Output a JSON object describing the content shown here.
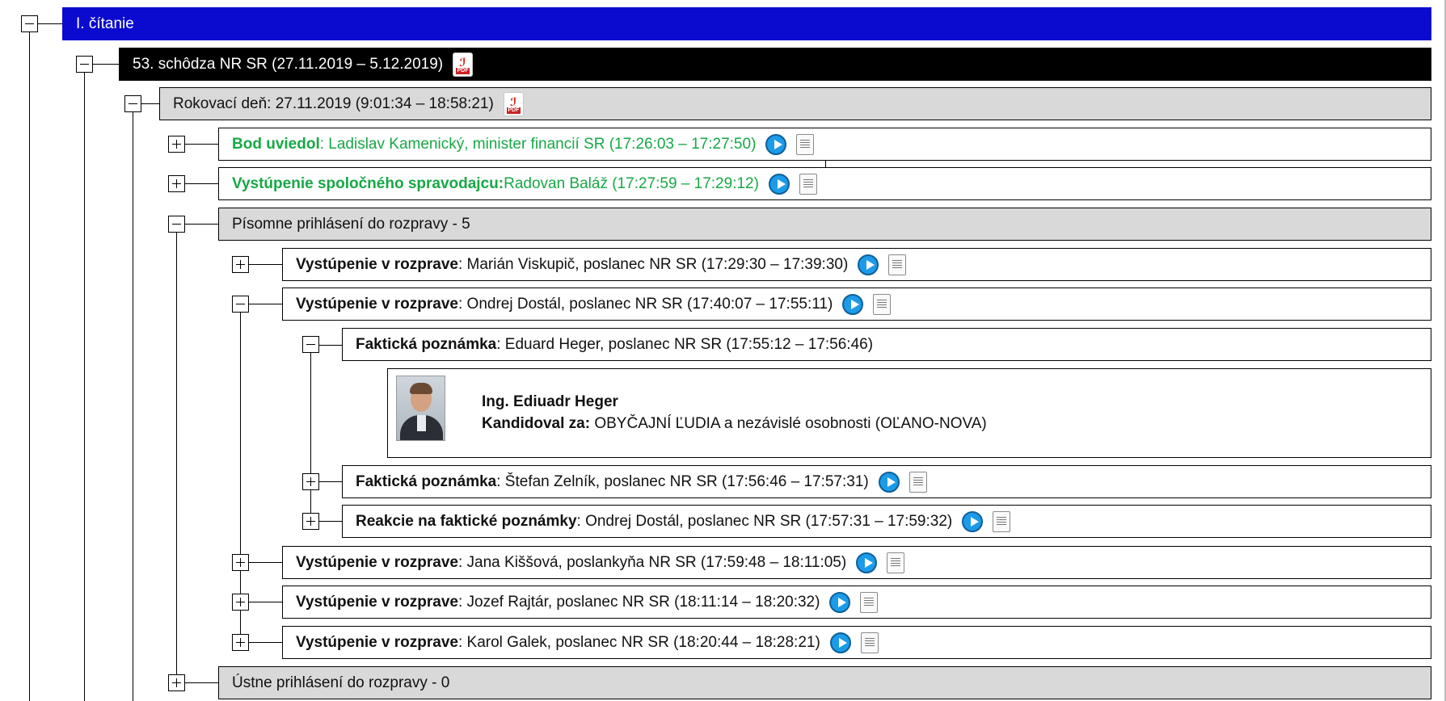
{
  "tree": {
    "level1": {
      "label": "I. čítanie"
    },
    "level2": {
      "label": "53. schôdza NR SR (27.11.2019 – 5.12.2019)"
    },
    "level3": {
      "label": "Rokovací deň: 27.11.2019 (9:01:34 – 18:58:21)"
    },
    "bod": {
      "prefix": "Bod uviedol",
      "rest": ": Ladislav Kamenický, minister financií SR (17:26:03 – 17:27:50)"
    },
    "spravodajca": {
      "prefix": "Vystúpenie spoločného spravodajcu:",
      "rest": " Radovan Baláž (17:27:59 – 17:29:12)"
    },
    "pisomne": {
      "label": "Písomne prihlásení do rozpravy - 5"
    },
    "speeches": [
      {
        "prefix": "Vystúpenie v rozprave",
        "rest": ": Marián Viskupič, poslanec NR SR (17:29:30 – 17:39:30)"
      },
      {
        "prefix": "Vystúpenie v rozprave",
        "rest": ": Ondrej Dostál, poslanec NR SR (17:40:07 – 17:55:11)"
      },
      {
        "prefix": "Vystúpenie v rozprave",
        "rest": ": Jana Kiššová, poslankyňa NR SR (17:59:48 – 18:11:05)"
      },
      {
        "prefix": "Vystúpenie v rozprave",
        "rest": ": Jozef Rajtár, poslanec NR SR (18:11:14 – 18:20:32)"
      },
      {
        "prefix": "Vystúpenie v rozprave",
        "rest": ": Karol Galek, poslanec NR SR (18:20:44 – 18:28:21)"
      }
    ],
    "factual": [
      {
        "prefix": "Faktická poznámka",
        "rest": ": Eduard Heger, poslanec NR SR (17:55:12 – 17:56:46)"
      },
      {
        "prefix": "Faktická poznámka",
        "rest": ": Štefan Zelník, poslanec NR SR (17:56:46 – 17:57:31)"
      },
      {
        "prefix": "Reakcie na faktické poznámky",
        "rest": ": Ondrej Dostál, poslanec NR SR (17:57:31 – 17:59:32)"
      }
    ],
    "person": {
      "name": "Ing. Ediuadr Heger",
      "party_label": "Kandidoval za:",
      "party": " OBYČAJNÍ ĽUDIA a nezávislé osobnosti (OĽANO-NOVA)"
    },
    "ustne": {
      "label": "Ústne prihlásení do rozpravy - 0"
    }
  },
  "icons": {
    "pdf_label": "PDF"
  },
  "colors": {
    "level1_bg": "#0b0bd0",
    "session_bg": "#000000",
    "group_bg": "#d9d9d9",
    "green": "#17a845"
  }
}
